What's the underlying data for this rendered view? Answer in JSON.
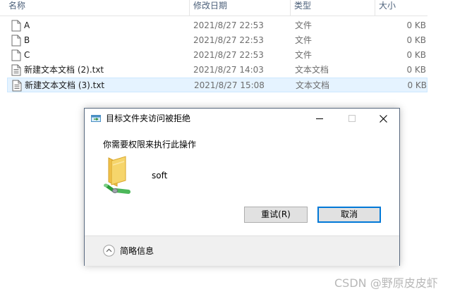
{
  "explorer": {
    "columns": {
      "name": "名称",
      "date": "修改日期",
      "type": "类型",
      "size": "大小"
    },
    "files": [
      {
        "name": "A",
        "date": "2021/8/27 22:53",
        "type": "文件",
        "size": "0 KB",
        "icon": "blank-file-icon",
        "selected": false
      },
      {
        "name": "B",
        "date": "2021/8/27 22:53",
        "type": "文件",
        "size": "0 KB",
        "icon": "blank-file-icon",
        "selected": false
      },
      {
        "name": "C",
        "date": "2021/8/27 22:53",
        "type": "文件",
        "size": "0 KB",
        "icon": "blank-file-icon",
        "selected": false
      },
      {
        "name": "新建文本文档 (2).txt",
        "date": "2021/8/27 14:03",
        "type": "文本文档",
        "size": "0 KB",
        "icon": "text-file-icon",
        "selected": false
      },
      {
        "name": "新建文本文档 (3).txt",
        "date": "2021/8/27 15:08",
        "type": "文本文档",
        "size": "0 KB",
        "icon": "text-file-icon",
        "selected": true
      }
    ]
  },
  "dialog": {
    "title": "目标文件夹访问被拒绝",
    "message": "你需要权限来执行此操作",
    "folder_name": "soft",
    "retry_label": "重试(R)",
    "cancel_label": "取消",
    "details_label": "简略信息",
    "accent_color": "#0078d7"
  },
  "watermark": "CSDN @野原皮皮虾"
}
